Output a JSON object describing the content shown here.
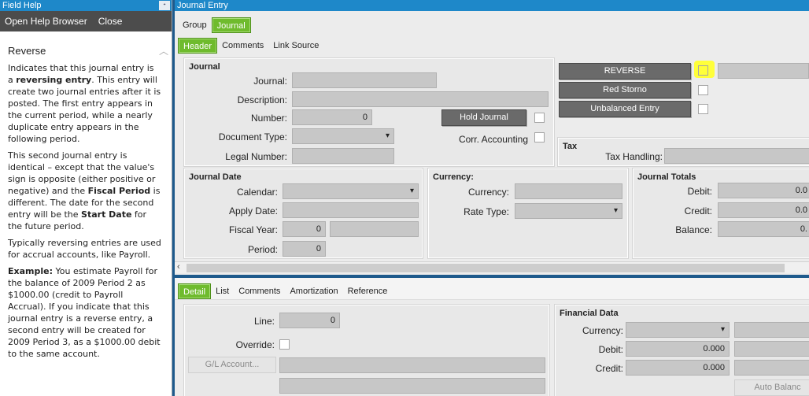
{
  "help": {
    "panel_title": "Field Help",
    "pin": "ᐩ",
    "toolbar": {
      "open_browser": "Open Help Browser",
      "close": "Close"
    },
    "heading": "Reverse",
    "p1a": "Indicates that this journal entry is a ",
    "p1b": "reversing entry",
    "p1c": ". This entry will create two journal entries after it is posted. The first entry appears in the current period, while a nearly duplicate entry appears in the following period.",
    "p2a": "This second journal entry is identical – except that the value's sign is opposite (either positive or negative) and the ",
    "p2b": "Fiscal Period",
    "p2c": " is different. The date for the second entry will be the ",
    "p2d": "Start Date",
    "p2e": " for the future period.",
    "p3": "Typically reversing entries are used for accrual accounts, like Payroll.",
    "p4a": "Example:",
    "p4b": " You estimate Payroll for the balance of 2009 Period 2 as $1000.00 (credit to Payroll Accrual). If you indicate that this journal entry is a reverse entry, a second entry will be created for 2009 Period 3, as a $1000.00 debit to the same account."
  },
  "journal": {
    "window_title": "Journal Entry",
    "top_tabs": [
      "Group",
      "Journal"
    ],
    "sub_tabs": [
      "Header",
      "Comments",
      "Link Source"
    ],
    "header": {
      "journal_section": "Journal",
      "journal_label": "Journal:",
      "description_label": "Description:",
      "number_label": "Number:",
      "number_value": "0",
      "document_type_label": "Document Type:",
      "legal_number_label": "Legal Number:",
      "hold_journal": "Hold Journal",
      "corr_accounting": "Corr. Accounting",
      "reverse": "REVERSE",
      "red_storno": "Red Storno",
      "unbalanced_entry": "Unbalanced Entry",
      "tax_section": "Tax",
      "tax_handling_label": "Tax Handling:",
      "journal_date_section": "Journal Date",
      "calendar_label": "Calendar:",
      "apply_date_label": "Apply Date:",
      "fiscal_year_label": "Fiscal Year:",
      "fiscal_year_value": "0",
      "period_label": "Period:",
      "period_value": "0",
      "currency_section": "Currency:",
      "currency_label": "Currency:",
      "rate_type_label": "Rate Type:",
      "totals_section": "Journal Totals",
      "debit_label": "Debit:",
      "debit_value": "0.0",
      "credit_label": "Credit:",
      "credit_value": "0.0",
      "balance_label": "Balance:",
      "balance_value": "0."
    },
    "detail_tabs": [
      "Detail",
      "List",
      "Comments",
      "Amortization",
      "Reference"
    ],
    "detail": {
      "line_label": "Line:",
      "line_value": "0",
      "override_label": "Override:",
      "gl_account": "G/L Account...",
      "financial_section": "Financial Data",
      "currency_label": "Currency:",
      "debit_label": "Debit:",
      "debit_value": "0.000",
      "credit_label": "Credit:",
      "credit_value": "0.000",
      "auto_balance": "Auto Balanc"
    },
    "highlight_color": "#ffff3a",
    "accent_tab_color": "#6fbb2d",
    "title_bar_color": "#1e88c9"
  }
}
